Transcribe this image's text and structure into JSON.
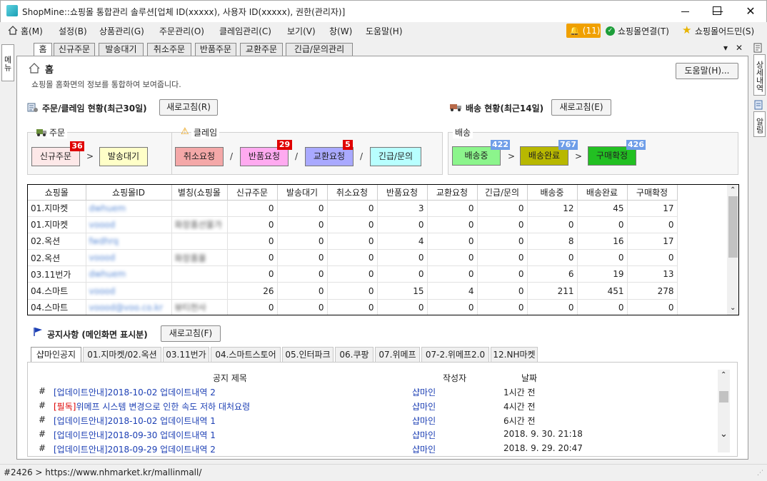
{
  "window": {
    "title": "ShopMine::쇼핑몰 통합관리 솔루션[업체 ID(xxxxx), 사용자 ID(xxxxx), 권한(관리자)]",
    "minimize": "—",
    "maximize": "☐",
    "close": "✕"
  },
  "menu": {
    "items": [
      "홈(M)",
      "설정(B)",
      "상품관리(G)",
      "주문관리(O)",
      "클레임관리(C)",
      "보기(V)",
      "창(W)",
      "도움말(H)"
    ],
    "alarm": "🔔 (11)",
    "mall_connect": "쇼핑몰연결(T)",
    "mall_admin": "쇼핑몰어드민(S)"
  },
  "left_strip": {
    "label": "메뉴"
  },
  "right_strip": {
    "detail": "상세내역",
    "alarm": "알림"
  },
  "tabs": [
    "홈",
    "신규주문",
    "발송대기",
    "취소주문",
    "반품주문",
    "교환주문",
    "긴급/문의관리"
  ],
  "tab_controls": {
    "dropdown": "▾",
    "close": "✕"
  },
  "home": {
    "title": "홈",
    "subtitle": "쇼핑몰 홈화면의 정보를 통합하여 보여줍니다.",
    "help_button": "도움말(H)..."
  },
  "order_status": {
    "title": "주문/클레임 현황(최근30일)",
    "refresh": "새로고침(R)",
    "order_group": "주문",
    "claim_group": "클레임",
    "boxes": {
      "new_order": {
        "label": "신규주문",
        "count": "36"
      },
      "ship_wait": {
        "label": "발송대기"
      },
      "cancel_req": {
        "label": "취소요청"
      },
      "return_req": {
        "label": "반품요청",
        "count": "29"
      },
      "exchange_req": {
        "label": "교환요청",
        "count": "5"
      },
      "urgent": {
        "label": "긴급/문의"
      }
    },
    "arrow": ">",
    "slash": "/"
  },
  "ship_status": {
    "title": "배송 현황(최근14일)",
    "refresh": "새로고침(E)",
    "group": "배송",
    "boxes": {
      "shipping": {
        "label": "배송중",
        "count": "422"
      },
      "delivered": {
        "label": "배송완료",
        "count": "767"
      },
      "confirmed": {
        "label": "구매확정",
        "count": "426"
      }
    },
    "arrow": ">"
  },
  "grid": {
    "columns": [
      "쇼핑몰",
      "쇼핑몰ID",
      "별칭(쇼핑몰",
      "신규주문",
      "발송대기",
      "취소요청",
      "반품요청",
      "교환요청",
      "긴급/문의",
      "배송중",
      "배송완료",
      "구매확정"
    ],
    "rows": [
      [
        "01.지마켓",
        "dwhuem",
        "",
        "0",
        "0",
        "0",
        "3",
        "0",
        "0",
        "12",
        "45",
        "17"
      ],
      [
        "01.지마켓",
        "voood",
        "화장품선물가",
        "0",
        "0",
        "0",
        "0",
        "0",
        "0",
        "0",
        "0",
        "0"
      ],
      [
        "02.옥션",
        "fwdhrq",
        "",
        "0",
        "0",
        "0",
        "4",
        "0",
        "0",
        "8",
        "16",
        "17"
      ],
      [
        "02.옥션",
        "voood",
        "화장품몰",
        "0",
        "0",
        "0",
        "0",
        "0",
        "0",
        "0",
        "0",
        "0"
      ],
      [
        "03.11번가",
        "dwhuem",
        "",
        "0",
        "0",
        "0",
        "0",
        "0",
        "0",
        "6",
        "19",
        "13"
      ],
      [
        "04.스마트",
        "voood",
        "",
        "26",
        "0",
        "0",
        "15",
        "4",
        "0",
        "211",
        "451",
        "278"
      ],
      [
        "04.스마트",
        "voood@voo.co.kr",
        "뷰티천사",
        "0",
        "0",
        "0",
        "0",
        "0",
        "0",
        "0",
        "0",
        "0"
      ]
    ]
  },
  "notice": {
    "title": "공지사항 (메인화면 표시분)",
    "refresh": "새로고침(F)",
    "tabs": [
      "샵마인공지",
      "01.지마켓/02.옥션",
      "03.11번가",
      "04.스마트스토어",
      "05.인터파크",
      "06.쿠팡",
      "07.위메프",
      "07-2.위메프2.0",
      "12.NH마켓"
    ],
    "columns": {
      "title": "공지 제목",
      "author": "작성자",
      "date": "날짜"
    },
    "rows": [
      {
        "hash": "#",
        "prefix": "",
        "title": "[업데이트안내]2018-10-02 업데이트내역 2",
        "author": "샵마인",
        "date": "1시간 전"
      },
      {
        "hash": "#",
        "prefix": "[필독]",
        "title": "위메프 시스템 변경으로 인한 속도 저하 대처요령",
        "author": "샵마인",
        "date": "4시간 전"
      },
      {
        "hash": "#",
        "prefix": "",
        "title": "[업데이트안내]2018-10-02 업데이트내역 1",
        "author": "샵마인",
        "date": "6시간 전"
      },
      {
        "hash": "#",
        "prefix": "",
        "title": "[업데이트안내]2018-09-30 업데이트내역 1",
        "author": "샵마인",
        "date": "2018. 9. 30. 21:18"
      },
      {
        "hash": "#",
        "prefix": "",
        "title": "[업데이트안내]2018-09-29 업데이트내역 2",
        "author": "샵마인",
        "date": "2018. 9. 29. 20:47"
      }
    ]
  },
  "status_bar": {
    "text": "#2426 > https://www.nhmarket.kr/mallinmall/"
  },
  "colors": {
    "new_order": "#fde8e8",
    "ship_wait": "#ffffc8",
    "cancel": "#f4a8a8",
    "return": "#ffaaf0",
    "exchange": "#a9a9ff",
    "urgent": "#b8ffff",
    "shipping": "#8cf58c",
    "delivered": "#b8b800",
    "confirmed": "#22c022",
    "badge_red": "#e00000",
    "badge_blue": "#6f9ee8"
  }
}
